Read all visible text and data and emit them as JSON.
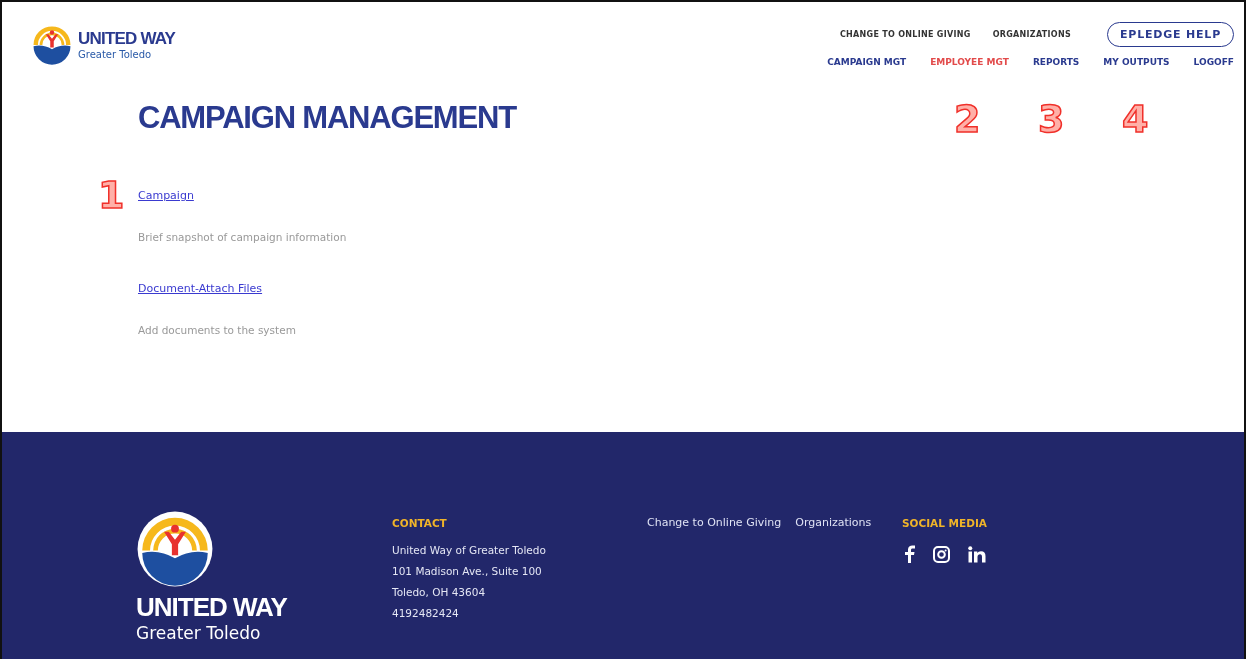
{
  "header": {
    "logo": {
      "title": "UNITED WAY",
      "subtitle": "Greater Toledo"
    },
    "top_links": [
      "CHANGE TO ONLINE GIVING",
      "ORGANIZATIONS"
    ],
    "help_button": "EPLEDGE HELP",
    "nav": [
      {
        "label": "CAMPAIGN MGT",
        "selected": false
      },
      {
        "label": "EMPLOYEE MGT",
        "selected": true
      },
      {
        "label": "REPORTS",
        "selected": false
      },
      {
        "label": "MY OUTPUTS",
        "selected": false
      },
      {
        "label": "LOGOFF",
        "selected": false
      }
    ]
  },
  "page": {
    "title": "CAMPAIGN MANAGEMENT",
    "items": [
      {
        "link": "Campaign",
        "description": "Brief snapshot of campaign information",
        "callout": "1"
      },
      {
        "link": "Document-Attach Files",
        "description": "Add documents to the system"
      }
    ]
  },
  "nav_callouts": [
    "2",
    "3",
    "4"
  ],
  "footer": {
    "logo": {
      "title": "UNITED WAY",
      "subtitle": "Greater Toledo"
    },
    "contact": {
      "heading": "CONTACT",
      "lines": [
        "United Way of Greater Toledo",
        "101 Madison Ave., Suite 100",
        "Toledo, OH 43604",
        "4192482424"
      ]
    },
    "links": [
      "Change to Online Giving",
      "Organizations"
    ],
    "social": {
      "heading": "SOCIAL MEDIA",
      "icons": [
        {
          "kind": "facebook"
        },
        {
          "kind": "instagram"
        },
        {
          "kind": "linkedin"
        }
      ]
    }
  }
}
